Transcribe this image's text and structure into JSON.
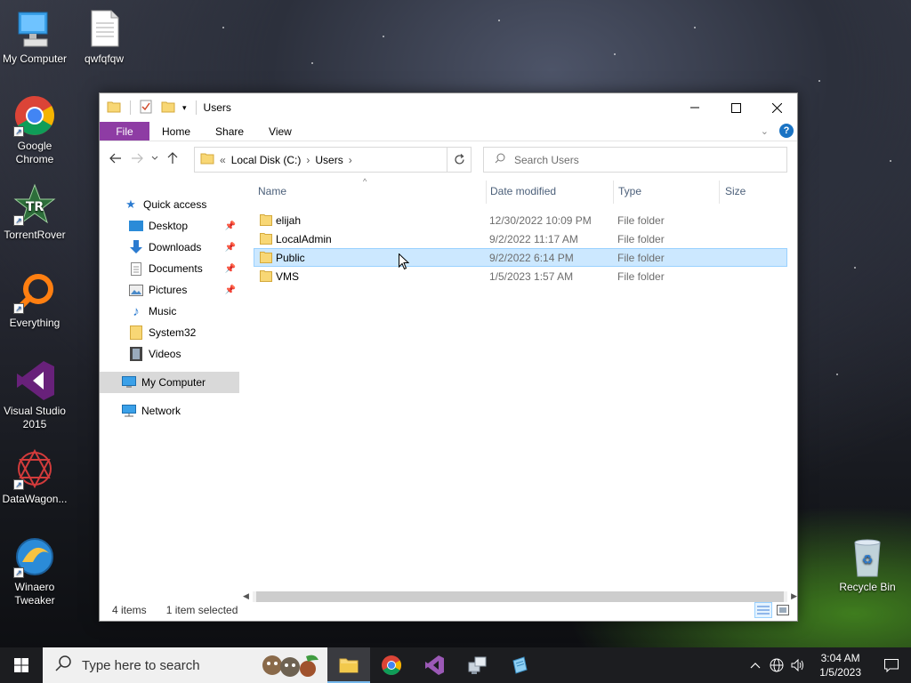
{
  "desktop": {
    "icons": [
      {
        "label": "My Computer",
        "icon": "computer-icon"
      },
      {
        "label": "qwfqfqw",
        "icon": "document-icon"
      },
      {
        "label": "Google Chrome",
        "icon": "chrome-icon"
      },
      {
        "label": "TorrentRover",
        "icon": "torrentrover-icon"
      },
      {
        "label": "Everything",
        "icon": "everything-icon"
      },
      {
        "label": "Visual Studio 2015",
        "icon": "visual-studio-icon"
      },
      {
        "label": "DataWagon...",
        "icon": "datawagon-icon"
      },
      {
        "label": "Winaero Tweaker",
        "icon": "winaero-icon"
      },
      {
        "label": "Recycle Bin",
        "icon": "recycle-bin-icon"
      }
    ]
  },
  "window": {
    "title": "Users",
    "ribbon_tabs": [
      "File",
      "Home",
      "Share",
      "View"
    ],
    "address": {
      "overflow": "«",
      "segments": [
        "Local Disk (C:)",
        "Users"
      ]
    },
    "search_placeholder": "Search Users",
    "nav": {
      "quick_access": "Quick access",
      "items": [
        {
          "label": "Desktop",
          "pinned": true
        },
        {
          "label": "Downloads",
          "pinned": true
        },
        {
          "label": "Documents",
          "pinned": true
        },
        {
          "label": "Pictures",
          "pinned": true
        },
        {
          "label": "Music",
          "pinned": false
        },
        {
          "label": "System32",
          "pinned": false
        },
        {
          "label": "Videos",
          "pinned": false
        }
      ],
      "my_computer": "My Computer",
      "network": "Network"
    },
    "columns": [
      "Name",
      "Date modified",
      "Type",
      "Size"
    ],
    "files": [
      {
        "name": "elijah",
        "date": "12/30/2022 10:09 PM",
        "type": "File folder",
        "selected": false
      },
      {
        "name": "LocalAdmin",
        "date": "9/2/2022 11:17 AM",
        "type": "File folder",
        "selected": false
      },
      {
        "name": "Public",
        "date": "9/2/2022 6:14 PM",
        "type": "File folder",
        "selected": true
      },
      {
        "name": "VMS",
        "date": "1/5/2023 1:57 AM",
        "type": "File folder",
        "selected": false
      }
    ],
    "status": {
      "items": "4 items",
      "selected": "1 item selected"
    }
  },
  "taskbar": {
    "search_placeholder": "Type here to search",
    "apps": [
      "file-explorer-icon",
      "chrome-icon",
      "visual-studio-icon",
      "network-share-icon",
      "notepad-icon"
    ],
    "time": "3:04 AM",
    "date": "1/5/2023"
  },
  "colors": {
    "file_tab": "#8e3ca4",
    "selection": "#cce8ff",
    "folder": "#f8d775"
  }
}
